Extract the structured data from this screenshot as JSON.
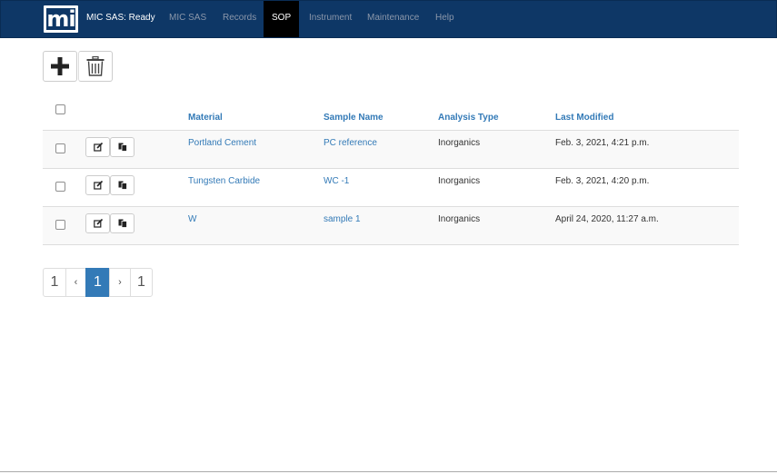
{
  "navbar": {
    "logo_text": "mi",
    "brand": "MIC SAS: Ready",
    "items": [
      {
        "label": "MIC SAS",
        "active": false
      },
      {
        "label": "Records",
        "active": false
      },
      {
        "label": "SOP",
        "active": true
      },
      {
        "label": "Instrument",
        "active": false
      },
      {
        "label": "Maintenance",
        "active": false
      },
      {
        "label": "Help",
        "active": false
      }
    ]
  },
  "toolbar": {
    "add_icon": "plus-icon",
    "delete_icon": "trash-icon"
  },
  "table": {
    "headers": [
      "Material",
      "Sample Name",
      "Analysis Type",
      "Last Modified"
    ],
    "rows": [
      {
        "material": "Portland Cement",
        "sample_name": "PC reference",
        "analysis_type": "Inorganics",
        "last_modified": "Feb. 3, 2021, 4:21 p.m."
      },
      {
        "material": "Tungsten Carbide",
        "sample_name": "WC -1",
        "analysis_type": "Inorganics",
        "last_modified": "Feb. 3, 2021, 4:20 p.m."
      },
      {
        "material": "W",
        "sample_name": "sample 1",
        "analysis_type": "Inorganics",
        "last_modified": "April 24, 2020, 11:27 a.m."
      }
    ],
    "row_actions": [
      "edit-icon",
      "copy-icon"
    ]
  },
  "pagination": {
    "first": "1",
    "prev": "‹",
    "current": "1",
    "next": "›",
    "last": "1"
  },
  "colors": {
    "navbar": "#0e3766",
    "link": "#337ab7",
    "active_nav": "#000000"
  }
}
